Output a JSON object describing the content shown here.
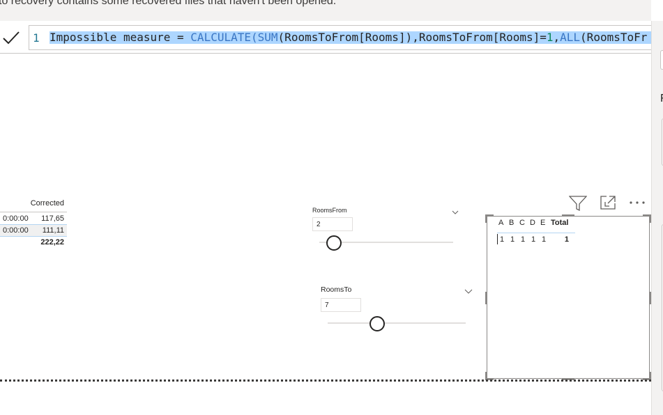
{
  "banner": {
    "text": "to recovery contains some recovered files that haven't been opened."
  },
  "formula_bar": {
    "line_number": "1",
    "code": {
      "t1": "Impossible measure = ",
      "f1": "CALCULATE",
      "p1": "(",
      "f2": "SUM",
      "t2": "(RoomsToFrom[Rooms]),RoomsToFrom[Rooms]=",
      "n1": "1",
      "t3": ",",
      "f3": "ALL",
      "t4": "(RoomsToFr"
    }
  },
  "right_panel": {
    "partial_char": "F"
  },
  "table": {
    "header": "Corrected",
    "rows": [
      {
        "time": "0:00:00",
        "value": "117,65"
      },
      {
        "time": "0:00:00",
        "value": "111,11"
      }
    ],
    "total": "222,22"
  },
  "slicer_rooms_from": {
    "title": "RoomsFrom",
    "value": "2",
    "slider_fraction": 0.11
  },
  "slicer_rooms_to": {
    "title": "RoomsTo",
    "value": "7",
    "slider_fraction": 0.36
  },
  "matrix": {
    "columns": [
      "A",
      "B",
      "C",
      "D",
      "E"
    ],
    "total_label": "Total",
    "row_values": [
      "1",
      "1",
      "1",
      "1",
      "1"
    ],
    "row_total": "1"
  },
  "icons": {
    "commit": "checkmark-icon",
    "filter": "filter-icon",
    "focus": "focus-mode-icon",
    "more": "more-options-icon",
    "chevron": "chevron-down-icon"
  }
}
